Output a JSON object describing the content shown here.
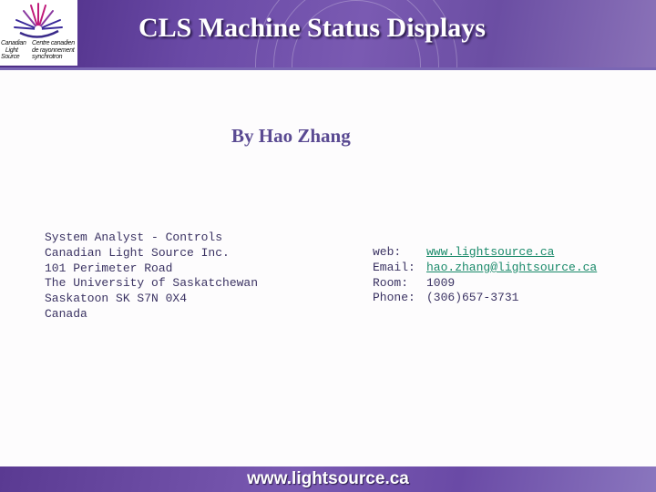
{
  "header": {
    "title": "CLS Machine Status Displays",
    "logo": {
      "icon": "cls-maple-leaf-burst-icon",
      "text_en": "Canadian\n   Light\nSource",
      "text_fr": "Centre canadien\nde rayonnement\nsynchrotron"
    }
  },
  "byline": "By Hao Zhang",
  "address": {
    "lines": [
      "System Analyst - Controls",
      "Canadian Light Source Inc.",
      "101 Perimeter Road",
      "The University of Saskatchewan",
      "Saskatoon SK S7N 0X4",
      "Canada"
    ]
  },
  "contact": {
    "web_label": "web:",
    "web_value": "www.lightsource.ca",
    "email_label": "Email:",
    "email_value": "hao.zhang@lightsource.ca",
    "room_label": "Room:",
    "room_value": "1009",
    "phone_label": "Phone:",
    "phone_value": "(306)657-3731"
  },
  "footer": {
    "url": "www.lightsource.ca"
  },
  "colors": {
    "header_purple": "#6a4aa6",
    "byline": "#5a4a92",
    "body_text": "#3a3262",
    "link": "#1a8a6a"
  }
}
